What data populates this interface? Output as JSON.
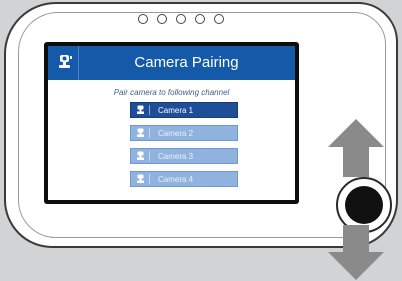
{
  "device": {
    "led_count": 5
  },
  "screen": {
    "header": {
      "icon": "camera-icon",
      "title": "Camera Pairing",
      "color": "#155aa8"
    },
    "subtitle": "Pair camera to following channel",
    "cameras": [
      {
        "label": "Camera 1",
        "selected": true,
        "icon": "camera-icon"
      },
      {
        "label": "Camera 2",
        "selected": false,
        "icon": "camera-icon"
      },
      {
        "label": "Camera 3",
        "selected": false,
        "icon": "camera-icon"
      },
      {
        "label": "Camera 4",
        "selected": false,
        "icon": "camera-icon"
      }
    ]
  },
  "controls": {
    "up_arrow": "up-arrow-icon",
    "down_arrow": "down-arrow-icon",
    "knob": "control-knob"
  },
  "colors": {
    "selected": "#1d4e97",
    "unselected": "#8fb3de",
    "arrow": "#8a8a8a"
  }
}
